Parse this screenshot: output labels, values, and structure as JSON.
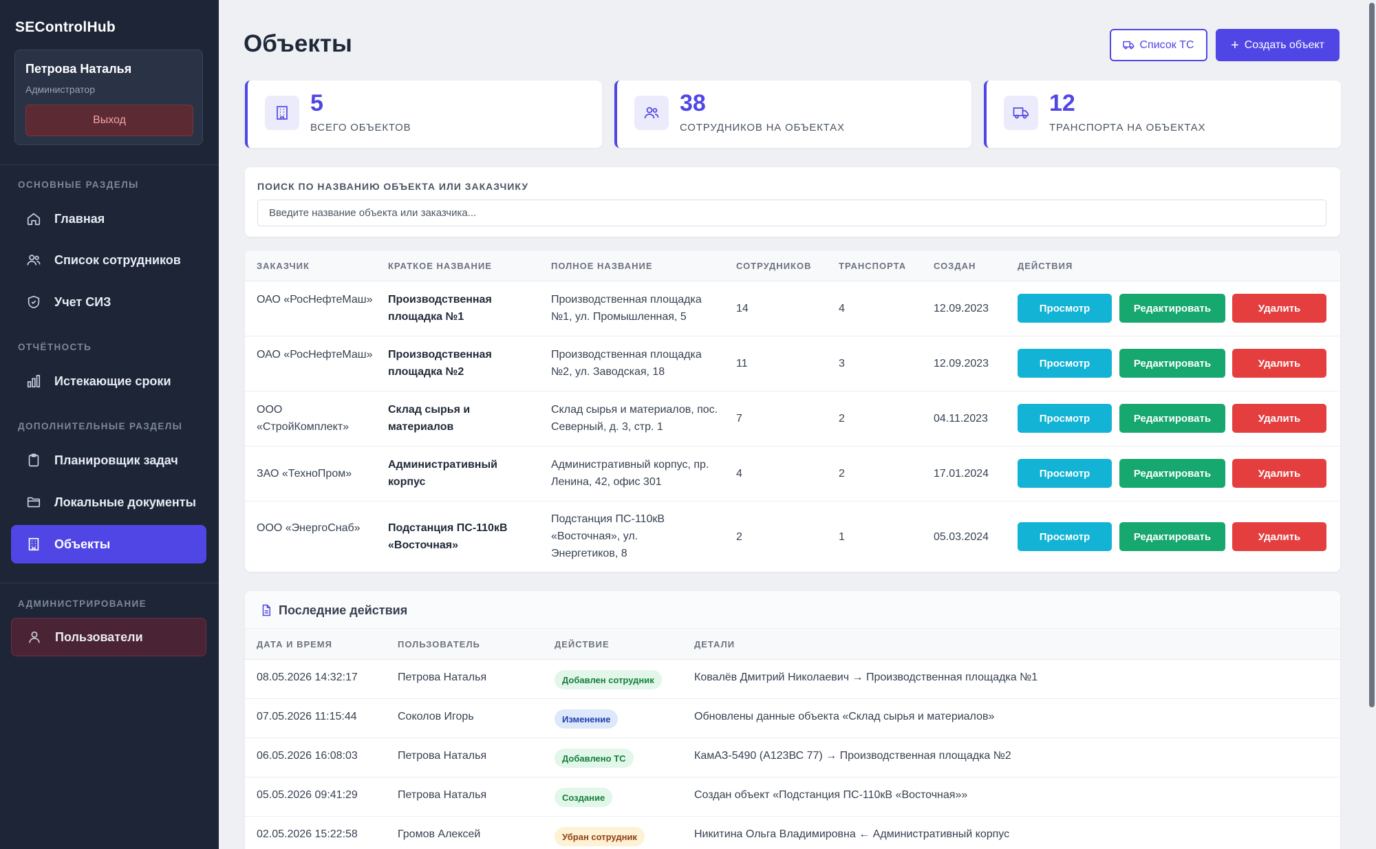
{
  "sidebar": {
    "brand": "SEControlHub",
    "user": {
      "name": "Петрова Наталья",
      "role": "Администратор",
      "logout": "Выход"
    },
    "sections": {
      "main": "ОСНОВНЫЕ РАЗДЕЛЫ",
      "reports": "ОТЧЁТНОСТЬ",
      "extra": "ДОПОЛНИТЕЛЬНЫЕ РАЗДЕЛЫ",
      "admin": "АДМИНИСТРИРОВАНИЕ"
    },
    "items": {
      "home": "Главная",
      "employees": "Список сотрудников",
      "ppe": "Учет СИЗ",
      "expiring": "Истекающие сроки",
      "planner": "Планировщик задач",
      "docs": "Локальные документы",
      "objects": "Объекты",
      "users": "Пользователи"
    }
  },
  "header": {
    "title": "Объекты",
    "vehicles_button": "Список ТС",
    "create_button": "Создать объект"
  },
  "stats": [
    {
      "value": "5",
      "label": "ВСЕГО ОБЪЕКТОВ",
      "icon": "building-icon"
    },
    {
      "value": "38",
      "label": "СОТРУДНИКОВ НА ОБЪЕКТАХ",
      "icon": "users-icon"
    },
    {
      "value": "12",
      "label": "ТРАНСПОРТА НА ОБЪЕКТАХ",
      "icon": "truck-icon"
    }
  ],
  "search": {
    "label": "ПОИСК ПО НАЗВАНИЮ ОБЪЕКТА ИЛИ ЗАКАЗЧИКУ",
    "placeholder": "Введите название объекта или заказчика..."
  },
  "objects_table": {
    "headers": [
      "ЗАКАЗЧИК",
      "КРАТКОЕ НАЗВАНИЕ",
      "ПОЛНОЕ НАЗВАНИЕ",
      "СОТРУДНИКОВ",
      "ТРАНСПОРТА",
      "СОЗДАН",
      "ДЕЙСТВИЯ"
    ],
    "actions": {
      "view": "Просмотр",
      "edit": "Редактировать",
      "delete": "Удалить"
    },
    "rows": [
      {
        "customer": "ОАО «РосНефтеМаш»",
        "short": "Производственная площадка №1",
        "full": "Производственная площадка №1, ул. Промышленная, 5",
        "employees": "14",
        "transport": "4",
        "created": "12.09.2023"
      },
      {
        "customer": "ОАО «РосНефтеМаш»",
        "short": "Производственная площадка №2",
        "full": "Производственная площадка №2, ул. Заводская, 18",
        "employees": "11",
        "transport": "3",
        "created": "12.09.2023"
      },
      {
        "customer": "ООО «СтройКомплект»",
        "short": "Склад сырья и материалов",
        "full": "Склад сырья и материалов, пос. Северный, д. 3, стр. 1",
        "employees": "7",
        "transport": "2",
        "created": "04.11.2023"
      },
      {
        "customer": "ЗАО «ТехноПром»",
        "short": "Административный корпус",
        "full": "Административный корпус, пр. Ленина, 42, офис 301",
        "employees": "4",
        "transport": "2",
        "created": "17.01.2024"
      },
      {
        "customer": "ООО «ЭнергоСнаб»",
        "short": "Подстанция ПС-110кВ «Восточная»",
        "full": "Подстанция ПС-110кВ «Восточная», ул. Энергетиков, 8",
        "employees": "2",
        "transport": "1",
        "created": "05.03.2024"
      }
    ]
  },
  "activity": {
    "title": "Последние действия",
    "headers": [
      "ДАТА И ВРЕМЯ",
      "ПОЛЬЗОВАТЕЛЬ",
      "ДЕЙСТВИЕ",
      "ДЕТАЛИ"
    ],
    "rows": [
      {
        "datetime": "08.05.2026 14:32:17",
        "user": "Петрова Наталья",
        "action": "Добавлен сотрудник",
        "details": "Ковалёв Дмитрий Николаевич → Производственная площадка №1"
      },
      {
        "datetime": "07.05.2026 11:15:44",
        "user": "Соколов Игорь",
        "action": "Изменение",
        "details": "Обновлены данные объекта «Склад сырья и материалов»"
      },
      {
        "datetime": "06.05.2026 16:08:03",
        "user": "Петрова Наталья",
        "action": "Добавлено ТС",
        "details": "КамАЗ-5490 (А123ВС 77) → Производственная площадка №2"
      },
      {
        "datetime": "05.05.2026 09:41:29",
        "user": "Петрова Наталья",
        "action": "Создание",
        "details": "Создан объект «Подстанция ПС-110кВ «Восточная»»"
      },
      {
        "datetime": "02.05.2026 15:22:58",
        "user": "Громов Алексей",
        "action": "Убран сотрудник",
        "details": "Никитина Ольга Владимировна ← Административный корпус"
      }
    ]
  },
  "colors": {
    "accent": "#4f46e5",
    "sidebar_bg": "#1d2537",
    "view": "#12b3d4",
    "edit": "#16a86e",
    "delete": "#e53e3e"
  }
}
